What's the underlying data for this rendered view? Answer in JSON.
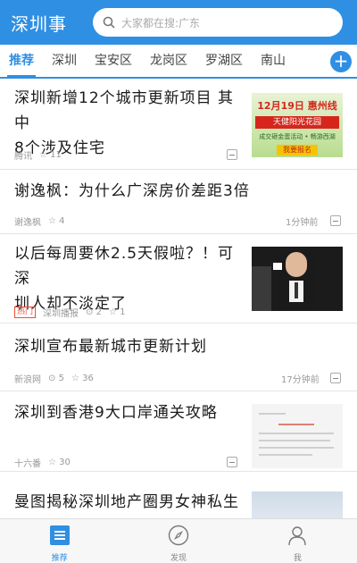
{
  "app": {
    "title": "深圳事"
  },
  "search": {
    "placeholder": "大家都在搜:广东",
    "icon": "search-icon"
  },
  "tabs": [
    {
      "label": "推荐",
      "active": true
    },
    {
      "label": "深圳"
    },
    {
      "label": "宝安区"
    },
    {
      "label": "龙岗区"
    },
    {
      "label": "罗湖区"
    },
    {
      "label": "南山"
    }
  ],
  "tab_add_label": "+",
  "feed": [
    {
      "title_lines": [
        "深圳新增12个城市更新项目 其中",
        "8个涉及住宅"
      ],
      "source": "腾讯",
      "stars": "11",
      "thumbnail": "ad",
      "ad": {
        "top_line": "12月19日 惠州线",
        "name": "天健阳光花园",
        "sub": "成交砸金蛋活动 • 畅游西湖",
        "button": "我要报名"
      }
    },
    {
      "title_lines": [
        "谢逸枫：为什么广深房价差距3倍"
      ],
      "source": "谢逸枫",
      "stars": "4",
      "time": "1分钟前"
    },
    {
      "title_lines": [
        "以后每周要休2.5天假啦？！可深",
        "圳人却不淡定了"
      ],
      "badge": "热门",
      "source": "深圳播报",
      "comments": "2",
      "stars": "1",
      "thumbnail": "photo"
    },
    {
      "title_lines": [
        "深圳宣布最新城市更新计划"
      ],
      "source": "新浪网",
      "comments": "5",
      "stars": "36",
      "time": "17分钟前"
    },
    {
      "title_lines": [
        "深圳到香港9大口岸通关攻略"
      ],
      "source": "十六番",
      "stars": "30",
      "thumbnail": "doc"
    },
    {
      "title_lines": [
        "曼图揭秘深圳地产圈男女神私生"
      ],
      "thumbnail": "city"
    }
  ],
  "bottom_nav": [
    {
      "label": "推荐",
      "icon": "news-icon",
      "active": true
    },
    {
      "label": "发现",
      "icon": "compass-icon"
    },
    {
      "label": "我",
      "icon": "user-icon"
    }
  ],
  "colors": {
    "brand": "#2f8fe3",
    "hot": "#e8503a"
  }
}
